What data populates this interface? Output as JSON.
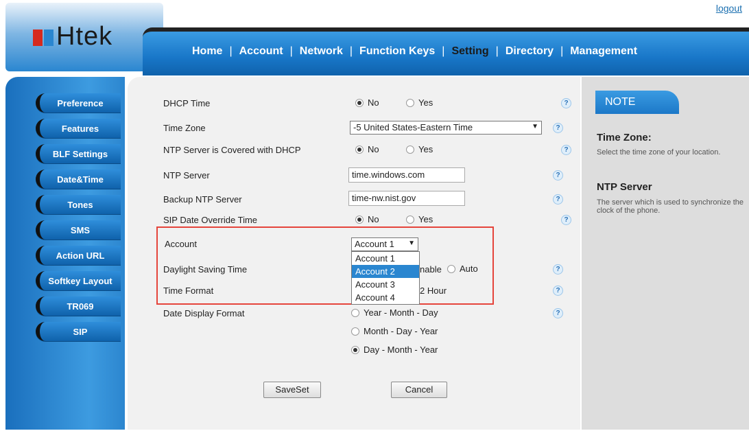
{
  "header": {
    "logout": "logout",
    "logo_text": "Htek",
    "nav": [
      "Home",
      "Account",
      "Network",
      "Function Keys",
      "Setting",
      "Directory",
      "Management"
    ],
    "nav_separator": "|"
  },
  "sidebar": {
    "items": [
      "Preference",
      "Features",
      "BLF Settings",
      "Date&Time",
      "Tones",
      "SMS",
      "Action URL",
      "Softkey Layout",
      "TR069",
      "SIP"
    ]
  },
  "form": {
    "dhcp_time": {
      "label": "DHCP Time",
      "opt_no": "No",
      "opt_yes": "Yes",
      "selected": "No"
    },
    "time_zone": {
      "label": "Time Zone",
      "value": "-5 United States-Eastern Time"
    },
    "ntp_dhcp": {
      "label": "NTP Server is Covered with DHCP",
      "opt_no": "No",
      "opt_yes": "Yes",
      "selected": "No"
    },
    "ntp_server": {
      "label": "NTP Server",
      "value": "time.windows.com"
    },
    "backup_ntp": {
      "label": "Backup NTP Server",
      "value": "time-nw.nist.gov"
    },
    "sip_override": {
      "label": "SIP Date Override Time",
      "opt_no": "No",
      "opt_yes": "Yes",
      "selected": "No"
    },
    "account": {
      "label": "Account",
      "value": "Account 1",
      "options": [
        "Account 1",
        "Account 2",
        "Account 3",
        "Account 4"
      ],
      "highlighted": "Account 2"
    },
    "dst": {
      "label": "Daylight Saving Time",
      "opt_enable_partial": "nable",
      "opt_auto": "Auto"
    },
    "time_format": {
      "label": "Time Format",
      "opt_partial": "2 Hour"
    },
    "date_format": {
      "label": "Date Display Format",
      "opt1": "Year - Month - Day",
      "opt2": "Month - Day - Year",
      "opt3": "Day - Month - Year",
      "selected": "Day - Month - Year"
    },
    "save": "SaveSet",
    "cancel": "Cancel",
    "help_glyph": "?"
  },
  "note": {
    "tab": "NOTE",
    "h1": "Time Zone:",
    "p1": "Select the time zone of your location.",
    "h2": "NTP Server",
    "p2": "The server which is used to synchronize the clock of the phone."
  },
  "colors": {
    "accent": "#2a86d0",
    "highlight_border": "#e5443b"
  }
}
